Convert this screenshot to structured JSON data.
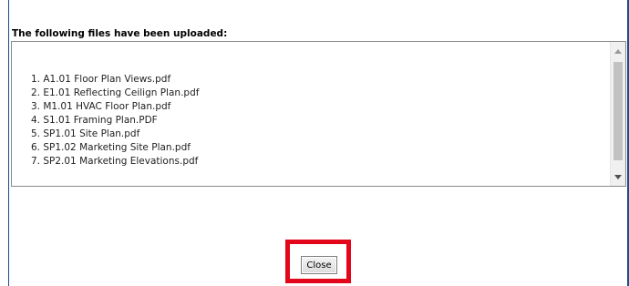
{
  "dialog": {
    "heading": "The following files have been uploaded:",
    "files": [
      "1. A1.01 Floor Plan Views.pdf",
      "2. E1.01 Reflecting Ceilign Plan.pdf",
      "3. M1.01 HVAC Floor Plan.pdf",
      "4. S1.01 Framing Plan.PDF",
      "5. SP1.01 Site Plan.pdf",
      "6. SP1.02 Marketing Site Plan.pdf",
      "7. SP2.01 Marketing Elevations.pdf"
    ],
    "close_label": "Close"
  },
  "colors": {
    "frame_border": "#1e4b8c",
    "highlight": "#e3061a",
    "scroll_thumb": "#c2c2c2"
  },
  "icons": {
    "scroll_up": "triangle-up-icon",
    "scroll_down": "triangle-down-icon"
  }
}
